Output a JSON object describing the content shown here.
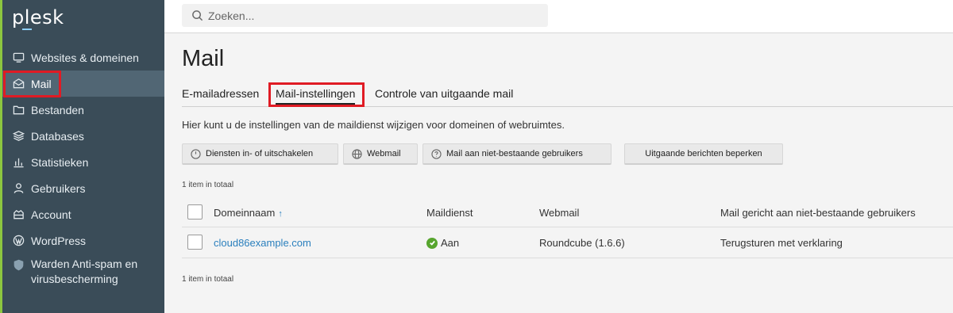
{
  "app": {
    "logo": "plesk"
  },
  "sidebar": {
    "items": [
      {
        "label": "Websites & domeinen",
        "icon": "monitor-icon"
      },
      {
        "label": "Mail",
        "icon": "mail-icon",
        "active": true
      },
      {
        "label": "Bestanden",
        "icon": "folder-icon"
      },
      {
        "label": "Databases",
        "icon": "layers-icon"
      },
      {
        "label": "Statistieken",
        "icon": "bar-chart-icon"
      },
      {
        "label": "Gebruikers",
        "icon": "user-icon"
      },
      {
        "label": "Account",
        "icon": "account-icon"
      },
      {
        "label": "WordPress",
        "icon": "wordpress-icon"
      },
      {
        "label": "Warden Anti-spam en virusbescherming",
        "icon": "shield-icon"
      }
    ]
  },
  "search": {
    "placeholder": "Zoeken..."
  },
  "page": {
    "title": "Mail"
  },
  "tabs": [
    {
      "label": "E-mailadressen"
    },
    {
      "label": "Mail-instellingen",
      "active": true
    },
    {
      "label": "Controle van uitgaande mail"
    }
  ],
  "description": "Hier kunt u de instellingen van de maildienst wijzigen voor domeinen of webruimtes.",
  "toolbar": {
    "btn_services": "Diensten in- of uitschakelen",
    "btn_webmail": "Webmail",
    "btn_nonexistent": "Mail aan niet-bestaande gebruikers",
    "btn_outgoing": "Uitgaande berichten beperken"
  },
  "count_text": "1 item in totaal",
  "table": {
    "columns": [
      "Domeinnaam",
      "Maildienst",
      "Webmail",
      "Mail gericht aan niet-bestaande gebruikers"
    ],
    "sort_indicator": "↑",
    "rows": [
      {
        "domain": "cloud86example.com",
        "mail_service": "Aan",
        "webmail": "Roundcube (1.6.6)",
        "nonexistent": "Terugsturen met verklaring"
      }
    ]
  },
  "colors": {
    "sidebar": "#3a4c58",
    "active_item": "#516674",
    "accent_green": "#8cc63f",
    "highlight_red": "#e01b24",
    "link": "#2a7fbd",
    "status_ok": "#57a52e"
  }
}
